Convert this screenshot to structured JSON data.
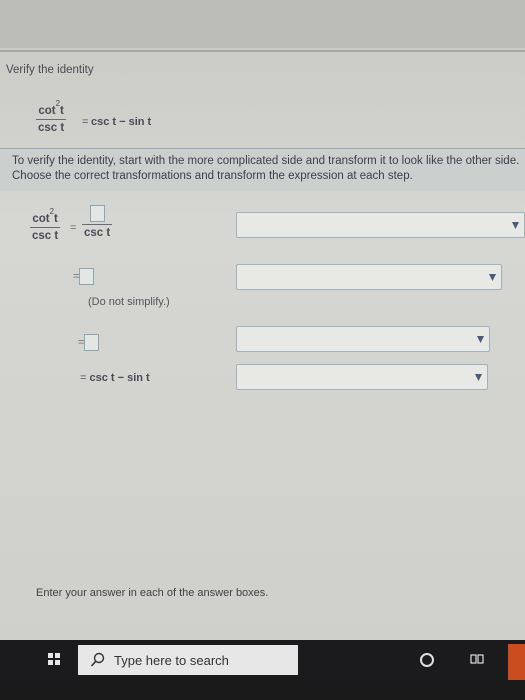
{
  "question": {
    "prompt": "Verify the identity",
    "identity": {
      "lhs_numerator": "cot",
      "lhs_exponent": "2",
      "lhs_var": "t",
      "lhs_denominator": "csc t",
      "equals": "=",
      "rhs": "csc t − sin t"
    },
    "instruction": "To verify the identity, start with the more complicated side and transform it to look like the other side. Choose the correct transformations and transform the expression at each step."
  },
  "steps": {
    "step1": {
      "numerator": "cot",
      "exponent": "2",
      "var": "t",
      "denominator": "csc t",
      "equals": "=",
      "rhs_denominator": "csc t"
    },
    "step2": {
      "equals": "="
    },
    "note": "(Do not simplify.)",
    "step3": {
      "equals": "="
    },
    "final": {
      "prefix": "= ",
      "expr": "csc t − sin t"
    }
  },
  "footer": "Enter your answer in each of the answer boxes.",
  "taskbar": {
    "search_placeholder": "Type here to search",
    "icons": [
      "windows-logo-icon",
      "search-icon",
      "cortana-icon",
      "task-view-icon"
    ]
  },
  "colors": {
    "accent_border": "#9fb1c3",
    "taskbar": "#1b1b1d"
  }
}
